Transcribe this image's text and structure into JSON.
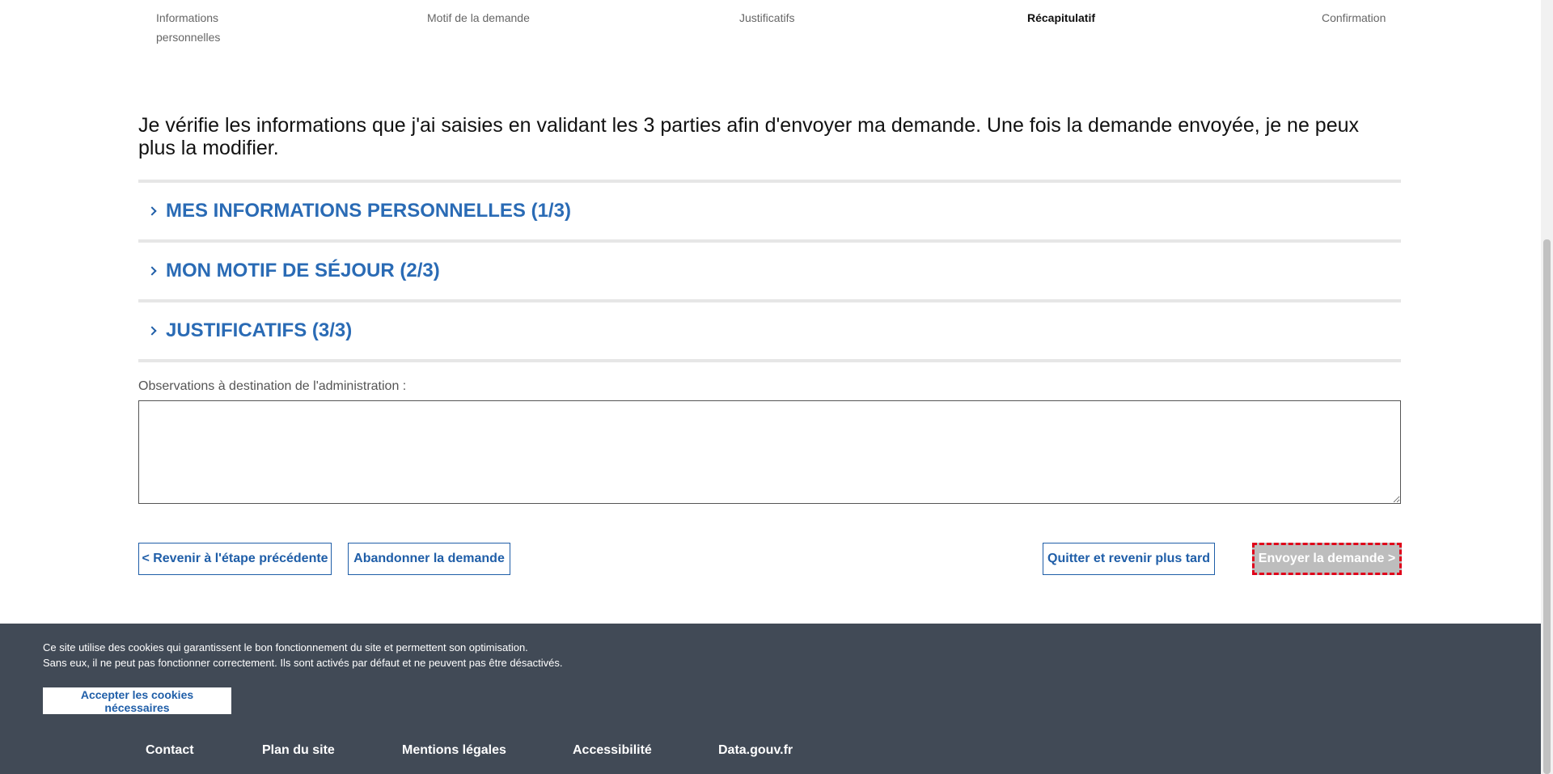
{
  "steps": [
    {
      "label": "Informations",
      "label2": "personnelles",
      "active": false
    },
    {
      "label": "Motif de la demande",
      "active": false
    },
    {
      "label": "Justificatifs",
      "active": false
    },
    {
      "label": "Récapitulatif",
      "active": true
    },
    {
      "label": "Confirmation",
      "active": false
    }
  ],
  "intro": "Je vérifie les informations que j'ai saisies en validant les 3 parties afin d'envoyer ma demande. Une fois la demande envoyée, je ne peux plus la modifier.",
  "accordion": [
    {
      "title": "MES INFORMATIONS PERSONNELLES (1/3)",
      "icon": "chevron-right-icon"
    },
    {
      "title": "MON MOTIF DE SÉJOUR (2/3)",
      "icon": "chevron-right-icon"
    },
    {
      "title": "JUSTIFICATIFS (3/3)",
      "icon": "chevron-right-icon"
    }
  ],
  "observations": {
    "label": "Observations à destination de l'administration :",
    "value": ""
  },
  "buttons": {
    "prev": "< Revenir à l'étape précédente",
    "abandon": "Abandonner la demande",
    "quit": "Quitter et revenir plus tard",
    "send": "Envoyer la demande >"
  },
  "cookie": {
    "line1": "Ce site utilise des cookies qui garantissent le bon fonctionnement du site et permettent son optimisation.",
    "line2": "Sans eux, il ne peut pas fonctionner correctement. Ils sont activés par défaut et ne peuvent pas être désactivés.",
    "accept": "Accepter les cookies nécessaires"
  },
  "footer_links": [
    "Contact",
    "Plan du site",
    "Mentions légales",
    "Accessibilité",
    "Data.gouv.fr"
  ],
  "colors": {
    "accent": "#2a6bb5",
    "footer_bg": "#414a56",
    "send_disabled_bg": "#bdbdbd",
    "focus_outline": "#e0001a"
  }
}
